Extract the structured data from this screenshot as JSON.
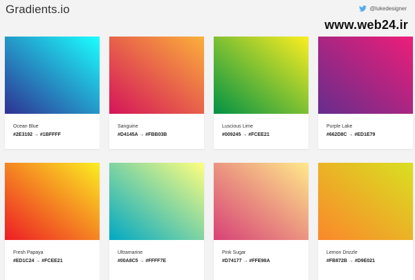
{
  "header": {
    "logo": "Gradients.io",
    "twitter_handle": "@lukedesigner",
    "watermark": "www.web24.ir"
  },
  "gradients": [
    {
      "name": "Ocean Blue",
      "codes": "#2E3192 → #1BFFFF",
      "from": "#2E3192",
      "to": "#1BFFFF"
    },
    {
      "name": "Sanguine",
      "codes": "#D4145A → #FBB03B",
      "from": "#D4145A",
      "to": "#FBB03B"
    },
    {
      "name": "Luscious Lime",
      "codes": "#009245 → #FCEE21",
      "from": "#009245",
      "to": "#FCEE21"
    },
    {
      "name": "Purple Lake",
      "codes": "#662D8C → #ED1E79",
      "from": "#662D8C",
      "to": "#ED1E79"
    },
    {
      "name": "Fresh Papaya",
      "codes": "#ED1C24 → #FCEE21",
      "from": "#ED1C24",
      "to": "#FCEE21"
    },
    {
      "name": "Ultramarine",
      "codes": "#00A8C5 → #FFFF7E",
      "from": "#00A8C5",
      "to": "#FFFF7E"
    },
    {
      "name": "Pink Sugar",
      "codes": "#D74177 → #FFE98A",
      "from": "#D74177",
      "to": "#FFE98A"
    },
    {
      "name": "Lemon Drizzle",
      "codes": "#FB872B → #D9E021",
      "from": "#FB872B",
      "to": "#D9E021"
    }
  ]
}
